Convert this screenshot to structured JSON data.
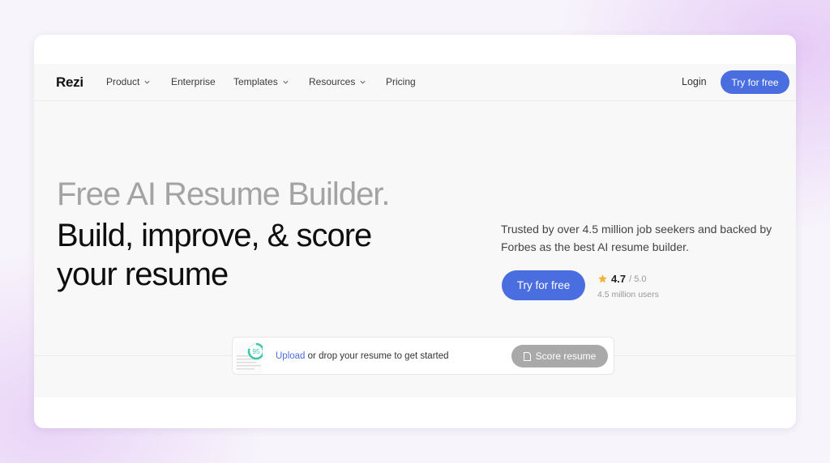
{
  "nav": {
    "logo": "Rezi",
    "items": [
      {
        "label": "Product",
        "dropdown": true
      },
      {
        "label": "Enterprise",
        "dropdown": false
      },
      {
        "label": "Templates",
        "dropdown": true
      },
      {
        "label": "Resources",
        "dropdown": true
      },
      {
        "label": "Pricing",
        "dropdown": false
      }
    ],
    "login": "Login",
    "cta": "Try for free"
  },
  "hero": {
    "headline_grey": "Free AI Resume Builder.",
    "headline_black": "Build, improve, & score your resume",
    "trust_text": "Trusted by over 4.5 million job seekers and backed by Forbes as the best AI resume builder.",
    "cta": "Try for free",
    "rating": {
      "value": "4.7",
      "max": "/ 5.0",
      "users": "4.5 million users"
    }
  },
  "upload": {
    "score_badge": "95",
    "link": "Upload",
    "text": " or drop your resume to get started",
    "button": "Score resume"
  },
  "colors": {
    "accent": "#4a6ee0",
    "star": "#f2b33d",
    "score_ring": "#3cc7a6"
  }
}
